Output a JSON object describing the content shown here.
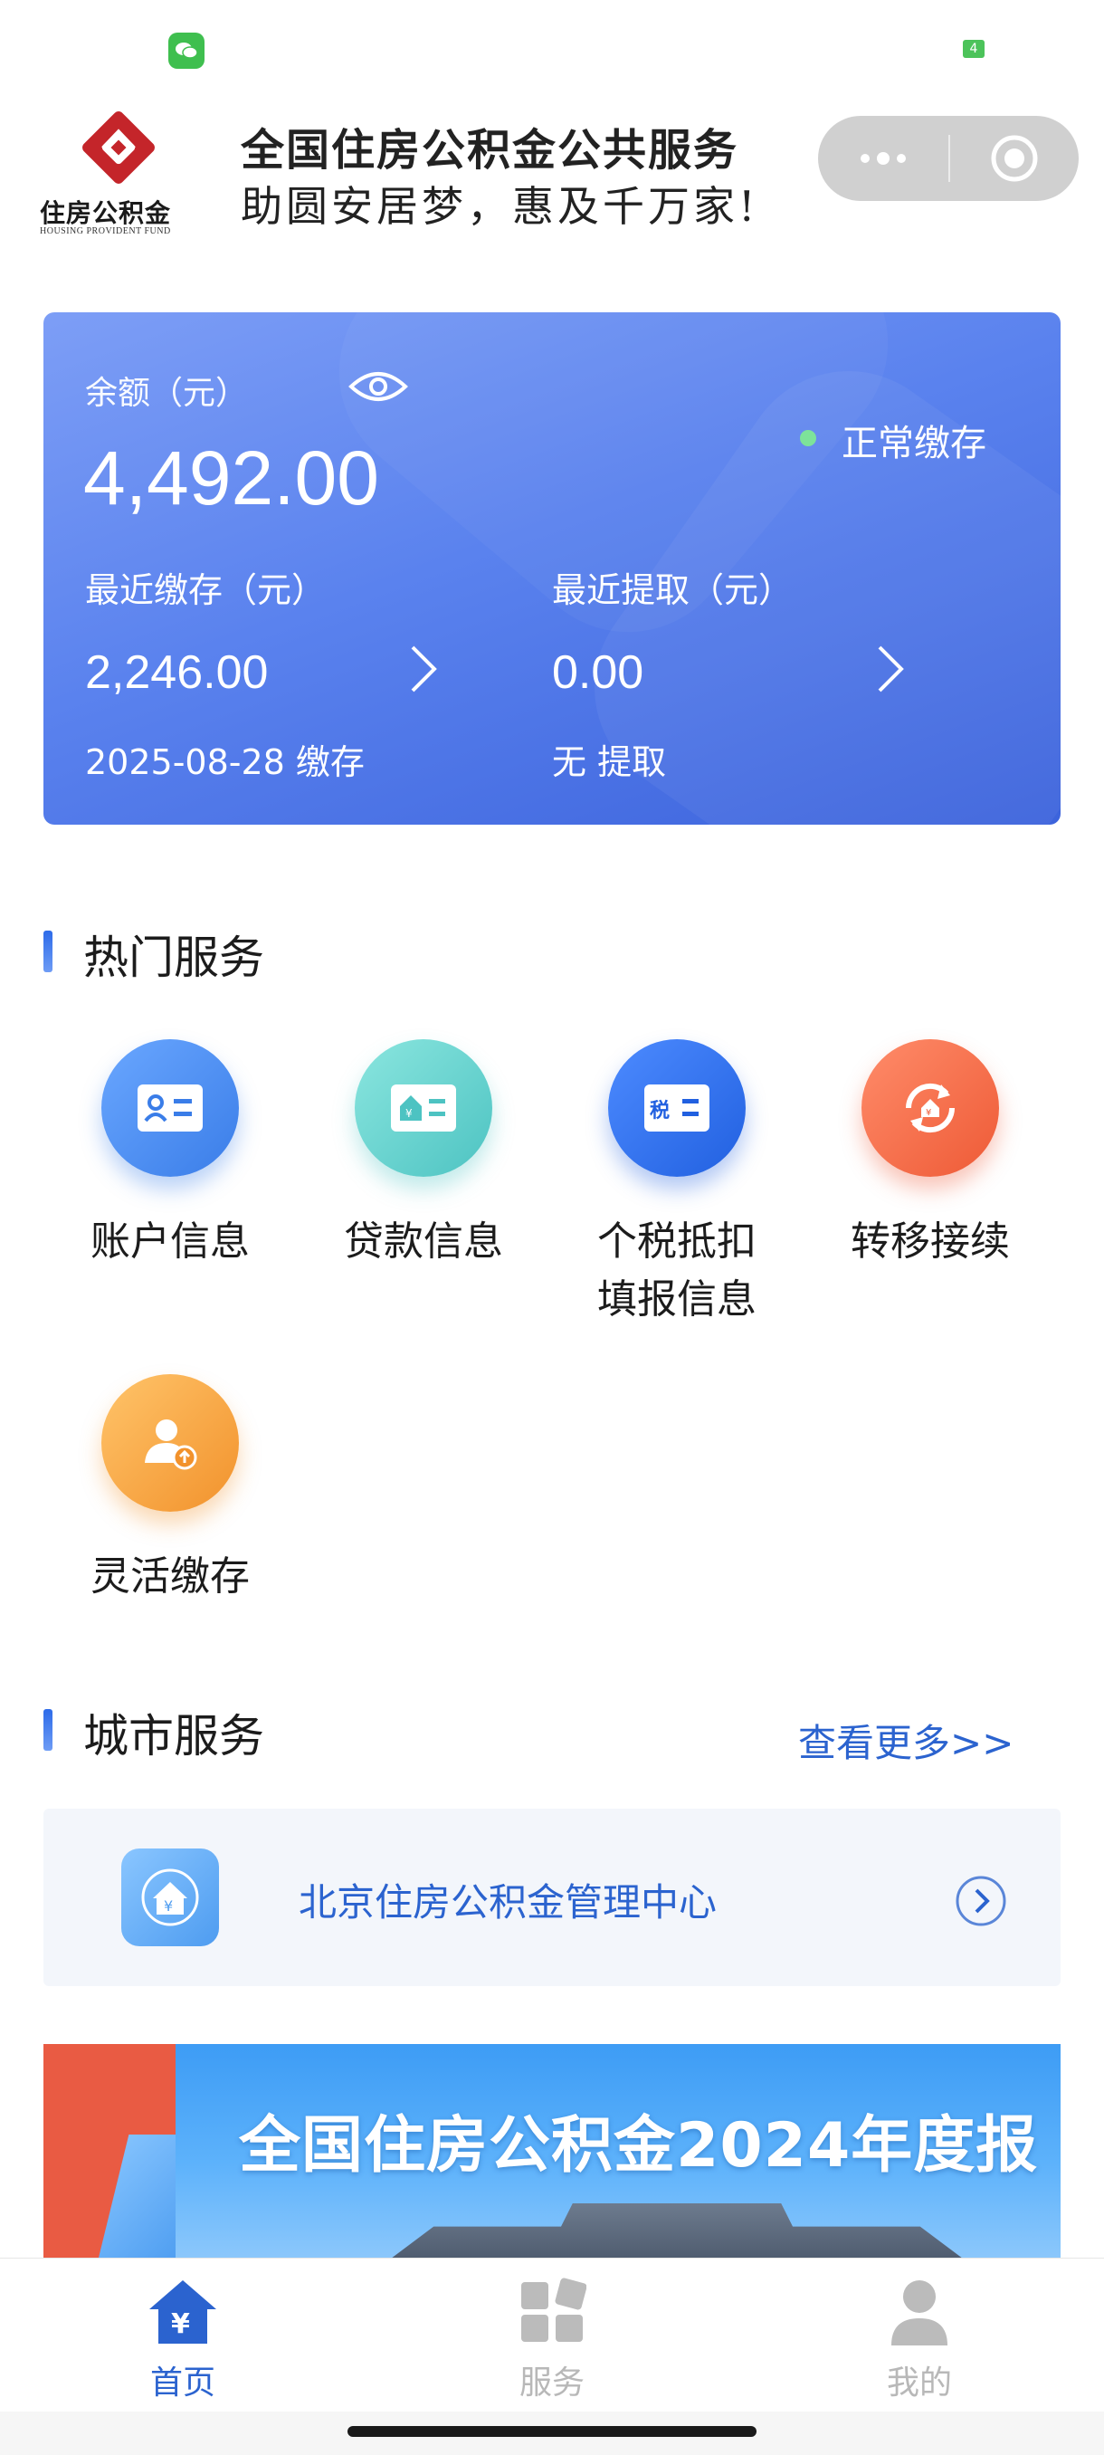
{
  "status_bar": {
    "battery_text": "4"
  },
  "header": {
    "logo_text": "住房公积金",
    "logo_subtext": "HOUSING PROVIDENT FUND",
    "title": "全国住房公积金公共服务",
    "slogan": "助圆安居梦，惠及千万家!"
  },
  "balance_card": {
    "balance_label": "余额（元）",
    "balance_value": "4,492.00",
    "account_status": "正常缴存",
    "recent_deposit_label": "最近缴存（元）",
    "recent_deposit_value": "2,246.00",
    "recent_deposit_date": "2025-08-28 缴存",
    "recent_withdraw_label": "最近提取（元）",
    "recent_withdraw_value": "0.00",
    "recent_withdraw_note": "无 提取"
  },
  "hot_services": {
    "title": "热门服务",
    "items": [
      {
        "label": "账户信息",
        "icon": "account-card-icon"
      },
      {
        "label": "贷款信息",
        "icon": "loan-card-icon"
      },
      {
        "label": "个税抵扣\n填报信息",
        "line1": "个税抵扣",
        "line2": "填报信息",
        "icon": "tax-card-icon"
      },
      {
        "label": "转移接续",
        "icon": "transfer-cycle-icon"
      },
      {
        "label": "灵活缴存",
        "icon": "flexible-deposit-icon"
      }
    ]
  },
  "city_services": {
    "title": "城市服务",
    "more_label": "查看更多>>",
    "items": [
      {
        "name": "北京住房公积金管理中心",
        "icon": "house-yuan-icon"
      }
    ]
  },
  "banner": {
    "title": "全国住房公积金2024年度报"
  },
  "tabbar": {
    "tabs": [
      {
        "label": "首页",
        "icon": "home-yuan-icon",
        "active": true
      },
      {
        "label": "服务",
        "icon": "services-grid-icon",
        "active": false
      },
      {
        "label": "我的",
        "icon": "user-icon",
        "active": false
      }
    ]
  },
  "colors": {
    "accent": "#2b63cf",
    "card_gradient_start": "#7d9ef6",
    "card_gradient_end": "#3c63dc",
    "status_dot": "#7de39a",
    "tab_active": "#2b63cf",
    "tab_inactive": "#b8b8b8"
  }
}
